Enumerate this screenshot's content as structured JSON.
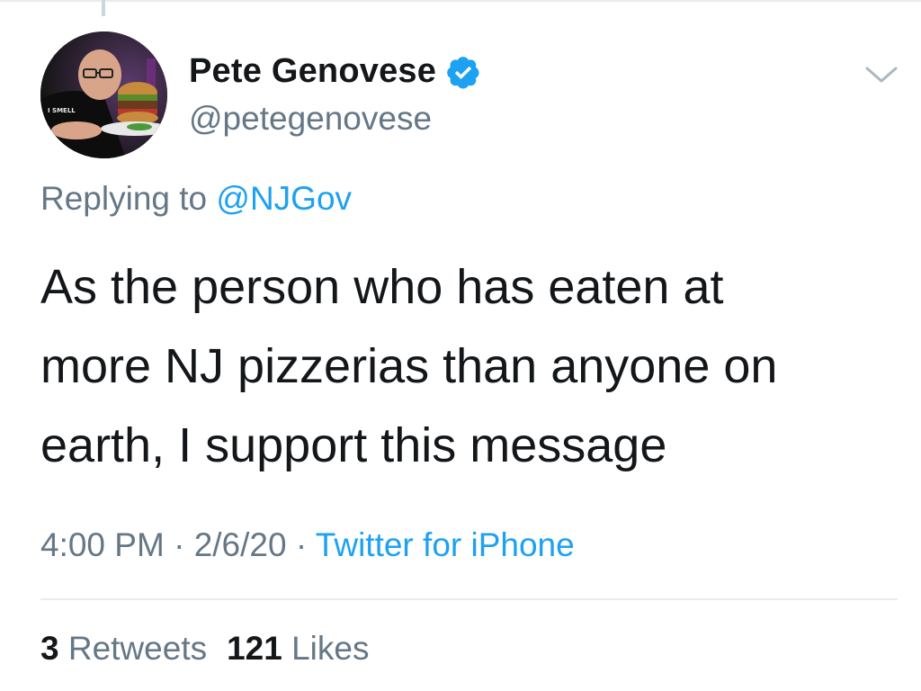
{
  "author": {
    "display_name": "Pete Genovese",
    "handle": "@petegenovese",
    "verified": true,
    "avatar_icon": "profile-photo",
    "avatar_shirt_text": "I SMELL"
  },
  "reply": {
    "prefix": "Replying to",
    "mention": "@NJGov"
  },
  "tweet": {
    "lines": [
      "As the person who has eaten at",
      "more NJ pizzerias than anyone on",
      "earth, I support this message"
    ]
  },
  "meta": {
    "time": "4:00 PM",
    "separator": "·",
    "date": "2/6/20",
    "source": "Twitter for iPhone"
  },
  "stats": {
    "retweets_count": "3",
    "retweets_label": "Retweets",
    "likes_count": "121",
    "likes_label": "Likes"
  },
  "icons": {
    "verified": "verified-badge-icon",
    "caret": "chevron-down-icon"
  },
  "colors": {
    "link_blue": "#1da1f2",
    "secondary_text": "#657786",
    "primary_text": "#14171a",
    "divider": "#e6ecf0"
  }
}
